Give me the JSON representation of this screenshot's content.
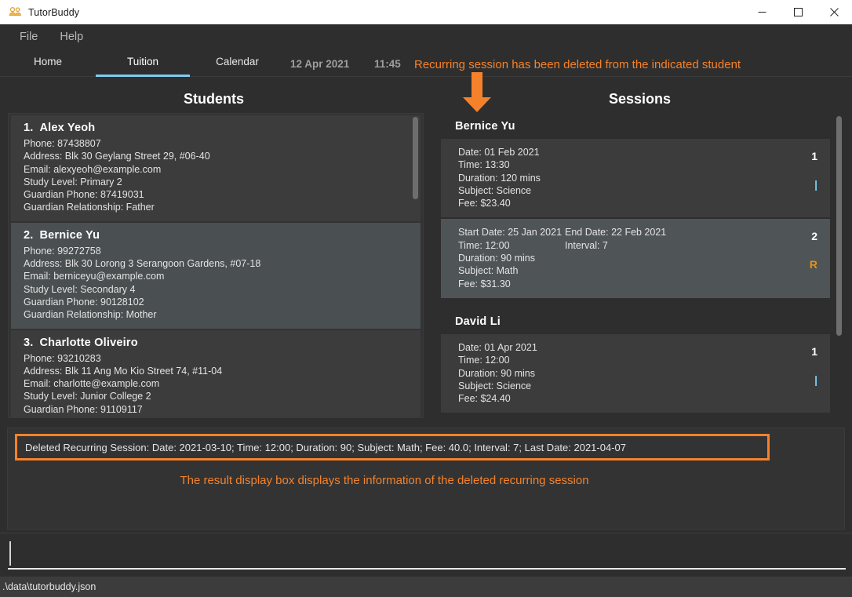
{
  "window": {
    "title": "TutorBuddy",
    "icon": "people-icon",
    "minimize_label": "—",
    "maximize_label": "□",
    "close_label": "✕"
  },
  "menu": {
    "items": [
      {
        "label": "File"
      },
      {
        "label": "Help"
      }
    ]
  },
  "tabs": [
    {
      "label": "Home",
      "selected": false
    },
    {
      "label": "Tuition",
      "selected": true
    },
    {
      "label": "Calendar",
      "selected": false
    }
  ],
  "clock": {
    "date": "12 Apr 2021",
    "time": "11:45"
  },
  "headings": {
    "students": "Students",
    "sessions": "Sessions"
  },
  "students": [
    {
      "index": "1.",
      "name": "Alex Yeoh",
      "phone": "Phone: 87438807",
      "address": "Address: Blk 30 Geylang Street 29, #06-40",
      "email": "Email: alexyeoh@example.com",
      "study_level": "Study Level: Primary 2",
      "guardian_phone": "Guardian Phone: 87419031",
      "guardian_relationship": "Guardian Relationship: Father"
    },
    {
      "index": "2.",
      "name": "Bernice Yu",
      "phone": "Phone: 99272758",
      "address": "Address: Blk 30 Lorong 3 Serangoon Gardens, #07-18",
      "email": "Email: berniceyu@example.com",
      "study_level": "Study Level: Secondary 4",
      "guardian_phone": "Guardian Phone: 90128102",
      "guardian_relationship": "Guardian Relationship: Mother"
    },
    {
      "index": "3.",
      "name": "Charlotte Oliveiro",
      "phone": "Phone: 93210283",
      "address": "Address: Blk 11 Ang Mo Kio Street 74, #11-04",
      "email": "Email: charlotte@example.com",
      "study_level": "Study Level: Junior College 2",
      "guardian_phone": "Guardian Phone: 91109117",
      "guardian_relationship": ""
    }
  ],
  "sessions": [
    {
      "student": "Bernice Yu",
      "cards": [
        {
          "index": "1",
          "flag": "|",
          "flag_type": "single",
          "highlight": false,
          "line1_a": "Date: 01 Feb 2021",
          "line1_b": "",
          "line2_a": "Time: 13:30",
          "line2_b": "",
          "line3_a": "Duration: 120 mins",
          "line4_a": "Subject: Science",
          "line5_a": "Fee: $23.40"
        },
        {
          "index": "2",
          "flag": "R",
          "flag_type": "recurring",
          "highlight": true,
          "line1_a": "Start Date: 25 Jan 2021",
          "line1_b": "End Date: 22 Feb 2021",
          "line2_a": "Time: 12:00",
          "line2_b": "Interval: 7",
          "line3_a": "Duration: 90 mins",
          "line4_a": "Subject: Math",
          "line5_a": "Fee: $31.30"
        }
      ]
    },
    {
      "student": "David Li",
      "cards": [
        {
          "index": "1",
          "flag": "|",
          "flag_type": "single",
          "highlight": false,
          "line1_a": "Date: 01 Apr 2021",
          "line1_b": "",
          "line2_a": "Time: 12:00",
          "line2_b": "",
          "line3_a": "Duration: 90 mins",
          "line4_a": "Subject: Science",
          "line5_a": "Fee: $24.40"
        }
      ]
    }
  ],
  "result": {
    "text": "Deleted Recurring Session: Date: 2021-03-10; Time: 12:00; Duration: 90; Subject: Math; Fee: 40.0; Interval: 7; Last Date: 2021-04-07"
  },
  "command": {
    "value": "",
    "placeholder": ""
  },
  "status": {
    "file_path": ".\\data\\tutorbuddy.json"
  },
  "annotations": {
    "top": "Recurring session has been deleted from the indicated student",
    "bottom": "The result display box displays the information of the deleted recurring session",
    "arrow": "down-arrow-annotation"
  },
  "colors": {
    "accent_orange": "#f5822b",
    "tab_underline": "#7ecdf0",
    "recurring_flag": "#e8930c",
    "single_flag": "#7ecdf0",
    "background": "#2e2e2e"
  }
}
